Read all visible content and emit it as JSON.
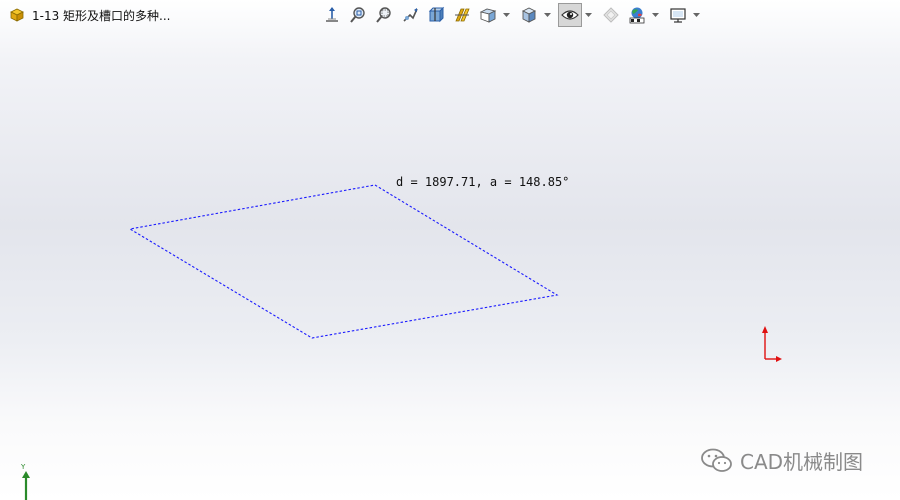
{
  "document": {
    "title": "1-13 矩形及槽口的多种...",
    "icon": "part-icon"
  },
  "toolbar": {
    "buttons": [
      {
        "icon": "normal-to-icon",
        "dropdown": false
      },
      {
        "icon": "zoom-to-fit-icon",
        "dropdown": false
      },
      {
        "icon": "zoom-to-area-icon",
        "dropdown": false
      },
      {
        "icon": "previous-view-icon",
        "dropdown": false
      },
      {
        "icon": "section-view-icon",
        "dropdown": false
      },
      {
        "icon": "dynamic-annotation-views-icon",
        "dropdown": false
      },
      {
        "icon": "view-orientation-icon",
        "dropdown": true
      },
      {
        "icon": "display-style-icon",
        "dropdown": true
      },
      {
        "icon": "hide-show-items-icon",
        "dropdown": true,
        "active": true
      },
      {
        "icon": "edit-appearance-icon",
        "dropdown": false
      },
      {
        "icon": "apply-scene-icon",
        "dropdown": true
      },
      {
        "icon": "view-settings-icon",
        "dropdown": true
      }
    ]
  },
  "viewport": {
    "measurement_label": "d = 1897.71, a = 148.85°",
    "sketch_color": "#1a1aff",
    "triad_color": "#e01010",
    "mini_axis_color": "#2a8a2a",
    "mini_axis_label": "Y"
  },
  "watermark": {
    "text": "CAD机械制图",
    "icon": "wechat-icon"
  }
}
